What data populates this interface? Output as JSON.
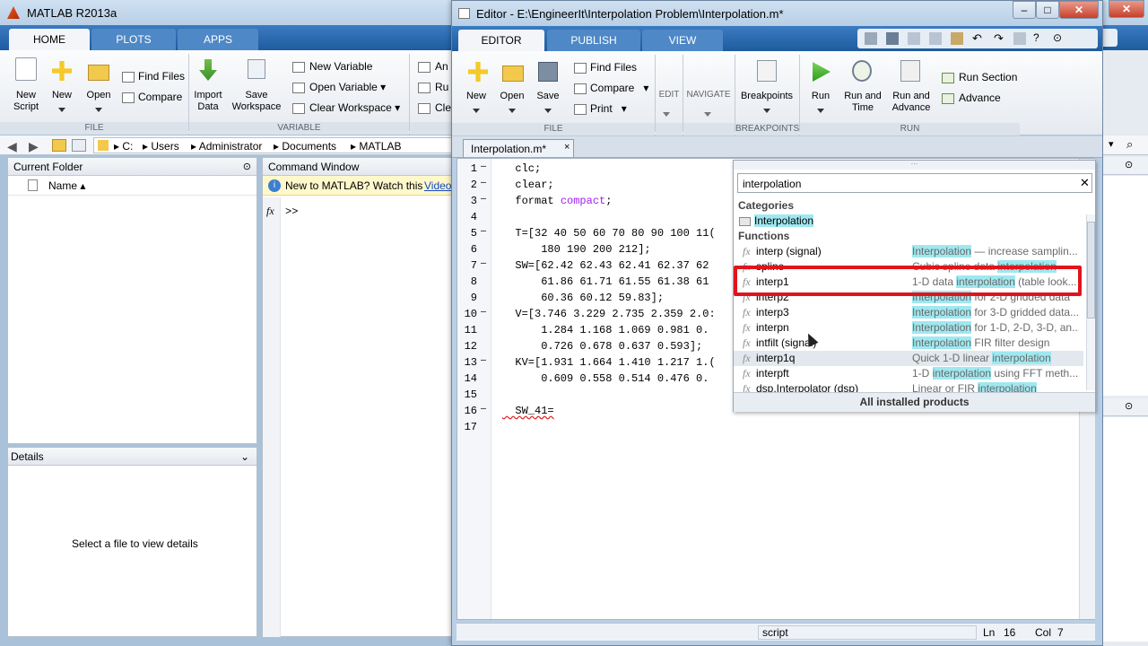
{
  "main_window": {
    "title": "MATLAB R2013a",
    "tabs": [
      "HOME",
      "PLOTS",
      "APPS"
    ]
  },
  "home_ribbon": {
    "file": {
      "new_script": "New\nScript",
      "new": "New",
      "open": "Open",
      "find_files": "Find Files",
      "compare": "Compare",
      "group": "FILE"
    },
    "variable": {
      "import_data": "Import\nData",
      "save_workspace": "Save\nWorkspace",
      "new_variable": "New Variable",
      "open_variable": "Open Variable",
      "clear_workspace": "Clear Workspace",
      "group": "VARIABLE"
    },
    "partial": [
      "An",
      "Ru",
      "Cle"
    ]
  },
  "address": {
    "path": [
      "C:",
      "Users",
      "Administrator",
      "Documents",
      "MATLAB"
    ]
  },
  "current_folder": {
    "title": "Current Folder",
    "col_name": "Name"
  },
  "details": {
    "title": "Details",
    "message": "Select a file to view details"
  },
  "command_window": {
    "title": "Command Window",
    "banner": "New to MATLAB? Watch this",
    "banner_link": "Video",
    "prompt": ">>",
    "fx": "fx"
  },
  "editor": {
    "title": "Editor - E:\\EngineerIt\\Interpolation Problem\\Interpolation.m*",
    "tabs": [
      "EDITOR",
      "PUBLISH",
      "VIEW"
    ],
    "file_group": {
      "new": "New",
      "open": "Open",
      "save": "Save",
      "find_files": "Find Files",
      "compare": "Compare",
      "print": "Print",
      "group": "FILE"
    },
    "edit": "EDIT",
    "navigate": "NAVIGATE",
    "breakpoints": {
      "label": "Breakpoints",
      "group": "BREAKPOINTS"
    },
    "run": {
      "run": "Run",
      "run_and_time": "Run and\nTime",
      "run_and_advance": "Run and\nAdvance",
      "run_section": "Run Section",
      "advance": "Advance",
      "group": "RUN"
    },
    "doc_tab": "Interpolation.m*",
    "lines": [
      {
        "n": "1",
        "dash": "—",
        "code": "  clc;"
      },
      {
        "n": "2",
        "dash": "—",
        "code": "  clear;"
      },
      {
        "n": "3",
        "dash": "—",
        "code": "  format ",
        "kw": "compact",
        "tail": ";"
      },
      {
        "n": "4",
        "dash": "",
        "code": ""
      },
      {
        "n": "5",
        "dash": "—",
        "code": "  T=[32 40 50 60 70 80 90 100 11("
      },
      {
        "n": "6",
        "dash": "",
        "code": "      180 190 200 212];"
      },
      {
        "n": "7",
        "dash": "—",
        "code": "  SW=[62.42 62.43 62.41 62.37 62"
      },
      {
        "n": "8",
        "dash": "",
        "code": "      61.86 61.71 61.55 61.38 61"
      },
      {
        "n": "9",
        "dash": "",
        "code": "      60.36 60.12 59.83];"
      },
      {
        "n": "10",
        "dash": "—",
        "code": "  V=[3.746 3.229 2.735 2.359 2.0:"
      },
      {
        "n": "11",
        "dash": "",
        "code": "      1.284 1.168 1.069 0.981 0."
      },
      {
        "n": "12",
        "dash": "",
        "code": "      0.726 0.678 0.637 0.593];"
      },
      {
        "n": "13",
        "dash": "—",
        "code": "  KV=[1.931 1.664 1.410 1.217 1.("
      },
      {
        "n": "14",
        "dash": "",
        "code": "      0.609 0.558 0.514 0.476 0."
      },
      {
        "n": "15",
        "dash": "",
        "code": ""
      },
      {
        "n": "16",
        "dash": "—",
        "code": "  SW_41="
      },
      {
        "n": "17",
        "dash": "",
        "code": ""
      }
    ],
    "status": {
      "mode": "script",
      "ln_label": "Ln",
      "ln": "16",
      "col_label": "Col",
      "col": "7"
    }
  },
  "search_popup": {
    "query": "interpolation",
    "categories_label": "Categories",
    "category": "Interpolation",
    "functions_label": "Functions",
    "functions": [
      {
        "name": "interp (signal)",
        "d_pre": "",
        "d_hl": "Interpolation",
        "d_post": " — increase samplin..."
      },
      {
        "name": "spline",
        "d_pre": "Cubic spline data ",
        "d_hl": "interpolation",
        "d_post": ""
      },
      {
        "name": "interp1",
        "d_pre": "1-D data ",
        "d_hl": "interpolation",
        "d_post": " (table look..."
      },
      {
        "name": "interp2",
        "d_pre": "",
        "d_hl": "Interpolation",
        "d_post": " for 2-D gridded data"
      },
      {
        "name": "interp3",
        "d_pre": "",
        "d_hl": "Interpolation",
        "d_post": " for 3-D gridded data..."
      },
      {
        "name": "interpn",
        "d_pre": "",
        "d_hl": "Interpolation",
        "d_post": " for 1-D, 2-D, 3-D, an..."
      },
      {
        "name": "intfilt (signal)",
        "d_pre": "",
        "d_hl": "Interpolation",
        "d_post": " FIR filter design"
      },
      {
        "name": "interp1q",
        "d_pre": "Quick 1-D linear ",
        "d_hl": "interpolation",
        "d_post": ""
      },
      {
        "name": "interpft",
        "d_pre": "1-D ",
        "d_hl": "interpolation",
        "d_post": " using FFT meth..."
      },
      {
        "name": "dsp.Interpolator (dsp)",
        "d_pre": "Linear or FIR ",
        "d_hl": "interpolation",
        "d_post": ""
      }
    ],
    "footer": "All installed products",
    "highlight_color": "#9fe8f0",
    "selection_box_color": "#e0141c"
  }
}
